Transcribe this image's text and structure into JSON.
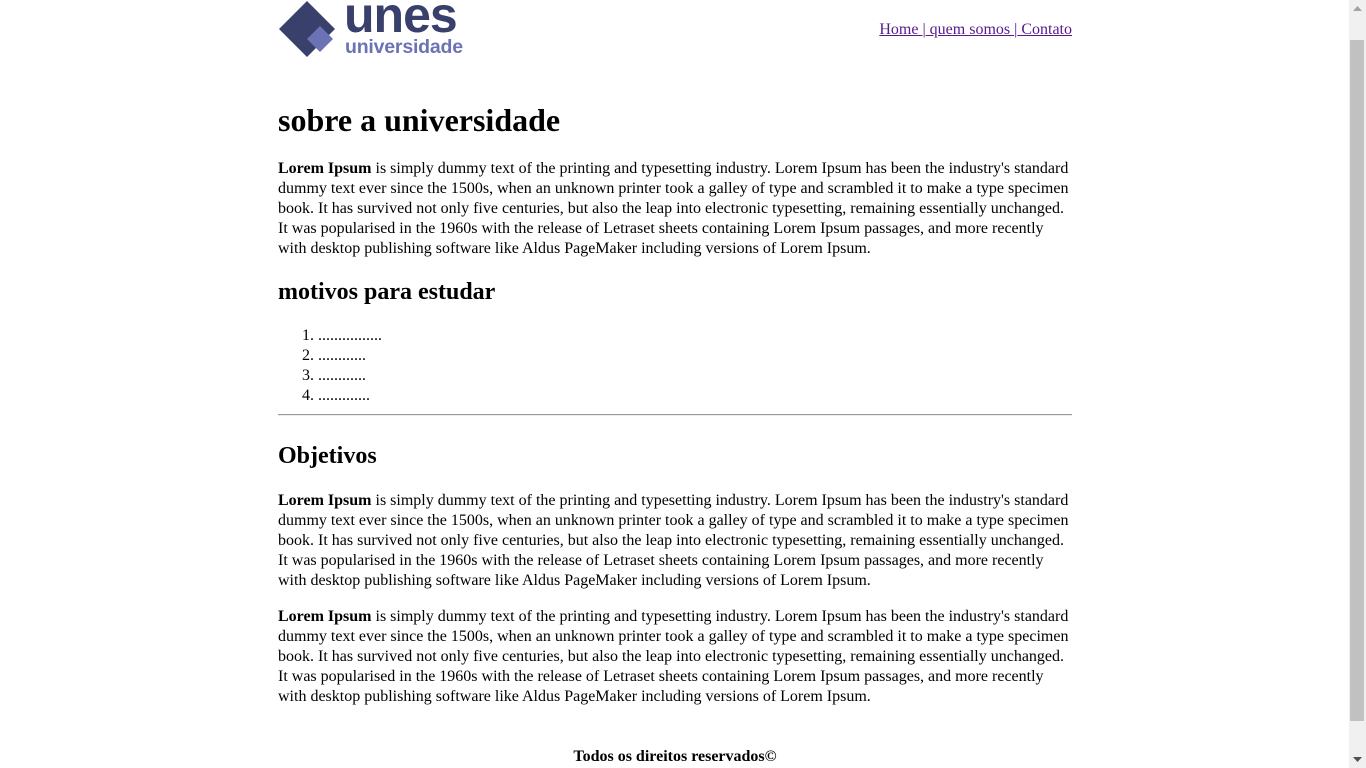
{
  "logo": {
    "big": "unes",
    "small": "universidade"
  },
  "nav": {
    "home": "Home ",
    "sep1": "|",
    "about": " quem somos ",
    "sep2": "|",
    "contact": " Contato"
  },
  "content": {
    "h1": "sobre a universidade",
    "p1": {
      "bold": "Lorem Ipsum",
      "text": " is simply dummy text of the printing and typesetting industry. Lorem Ipsum has been the industry's standard dummy text ever since the 1500s, when an unknown printer took a galley of type and scrambled it to make a type specimen book. It has survived not only five centuries, but also the leap into electronic typesetting, remaining essentially unchanged. It was popularised in the 1960s with the release of Letraset sheets containing Lorem Ipsum passages, and more recently with desktop publishing software like Aldus PageMaker including versions of Lorem Ipsum."
    },
    "h2_motivos": "motivos para estudar",
    "motivos": [
      "................",
      "............",
      "............",
      "............."
    ],
    "h2_objetivos": "Objetivos",
    "p2": {
      "bold": "Lorem Ipsum",
      "text": " is simply dummy text of the printing and typesetting industry. Lorem Ipsum has been the industry's standard dummy text ever since the 1500s, when an unknown printer took a galley of type and scrambled it to make a type specimen book. It has survived not only five centuries, but also the leap into electronic typesetting, remaining essentially unchanged. It was popularised in the 1960s with the release of Letraset sheets containing Lorem Ipsum passages, and more recently with desktop publishing software like Aldus PageMaker including versions of Lorem Ipsum."
    },
    "p3": {
      "bold": "Lorem Ipsum",
      "text": " is simply dummy text of the printing and typesetting industry. Lorem Ipsum has been the industry's standard dummy text ever since the 1500s, when an unknown printer took a galley of type and scrambled it to make a type specimen book. It has survived not only five centuries, but also the leap into electronic typesetting, remaining essentially unchanged. It was popularised in the 1960s with the release of Letraset sheets containing Lorem Ipsum passages, and more recently with desktop publishing software like Aldus PageMaker including versions of Lorem Ipsum."
    }
  },
  "footer": {
    "text": "Todos os direitos reservados©"
  },
  "colors": {
    "logo_dark": "#39406b",
    "logo_light": "#6b73b5",
    "link": "#551a8b"
  },
  "icons": {
    "scroll_up": "triangle-up-icon",
    "scroll_down": "triangle-down-icon"
  }
}
